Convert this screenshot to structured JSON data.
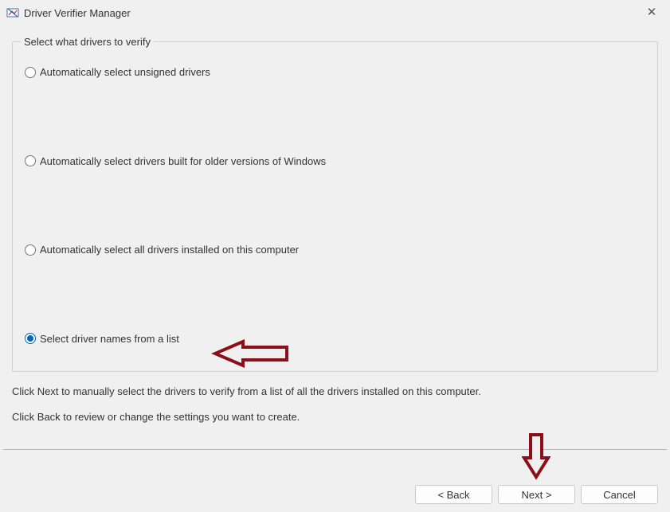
{
  "titlebar": {
    "title": "Driver Verifier Manager"
  },
  "fieldset": {
    "legend": "Select what drivers to verify",
    "options": [
      {
        "label": "Automatically select unsigned drivers",
        "selected": false
      },
      {
        "label": "Automatically select drivers built for older versions of Windows",
        "selected": false
      },
      {
        "label": "Automatically select all drivers installed on this computer",
        "selected": false
      },
      {
        "label": "Select driver names from a list",
        "selected": true
      }
    ]
  },
  "instructions": {
    "line1": "Click Next to manually select the drivers to verify from a list of all the drivers installed on this computer.",
    "line2": "Click Back to review or change the settings you want to create."
  },
  "buttons": {
    "back": "< Back",
    "next": "Next >",
    "cancel": "Cancel"
  },
  "annotations": {
    "arrow_color": "#8b0e1a"
  }
}
